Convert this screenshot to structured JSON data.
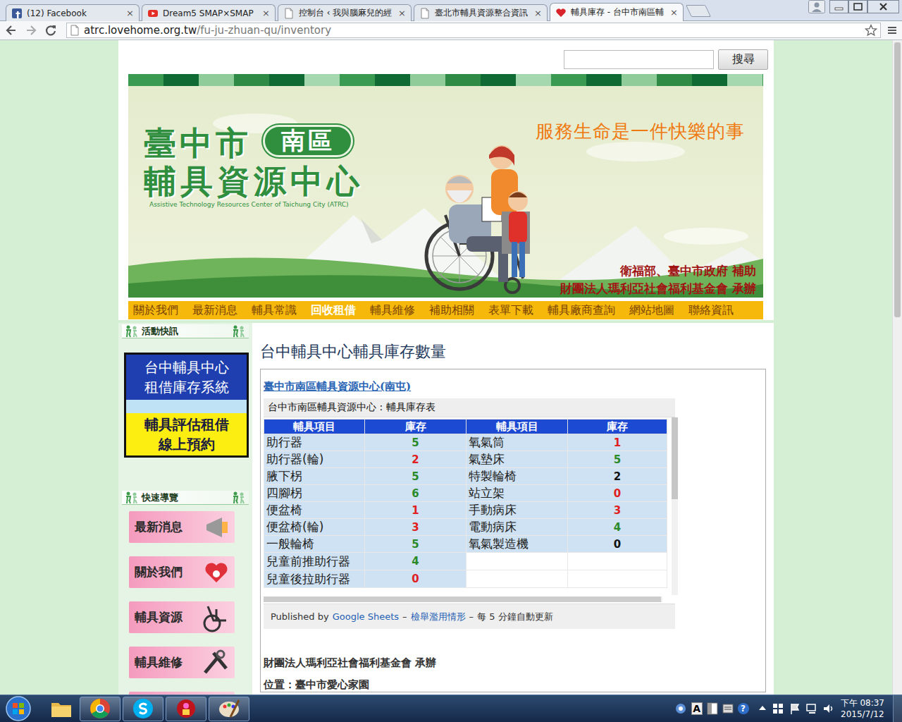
{
  "browser": {
    "tabs": [
      {
        "label": "(12) Facebook",
        "selected": false
      },
      {
        "label": "Dream5 SMAP×SMAP",
        "selected": false
      },
      {
        "label": "控制台 ‹ 我與腦麻兒的經",
        "selected": false
      },
      {
        "label": "臺北市輔具資源整合資訊",
        "selected": false
      },
      {
        "label": "輔具庫存 - 台中市南區輔",
        "selected": true
      }
    ],
    "tab_close": "×",
    "address": {
      "host": "atrc.lovehome.org.tw",
      "path": "/fu-ju-zhuan-qu/inventory"
    }
  },
  "page": {
    "search": {
      "button": "搜尋"
    },
    "banner": {
      "city": "臺中市",
      "district": "南區",
      "center": "輔具資源中心",
      "english": "Assistive Technology Resources Center of Taichung City (ATRC)",
      "slogan": "服務生命是一件快樂的事",
      "credits": [
        "衛福部、臺中市政府 補助",
        "財團法人瑪利亞社會福利基金會 承辦"
      ]
    },
    "nav": [
      {
        "label": "關於我們",
        "selected": false
      },
      {
        "label": "最新消息",
        "selected": false
      },
      {
        "label": "輔具常識",
        "selected": false
      },
      {
        "label": "回收租借",
        "selected": true
      },
      {
        "label": "輔具維修",
        "selected": false
      },
      {
        "label": "補助相關",
        "selected": false
      },
      {
        "label": "表單下載",
        "selected": false
      },
      {
        "label": "輔具廠商查詢",
        "selected": false
      },
      {
        "label": "網站地圖",
        "selected": false
      },
      {
        "label": "聯絡資訊",
        "selected": false
      }
    ],
    "sidebar": {
      "news_header": "活動快訊",
      "promo": {
        "system": [
          "台中輔具中心",
          "租借庫存系統"
        ],
        "booking": [
          "輔具評估租借",
          "線上預約"
        ]
      },
      "quick_header": "快速導覽",
      "quick_links": [
        "最新消息",
        "關於我們",
        "輔具資源",
        "輔具維修"
      ]
    },
    "main": {
      "title": "台中輔具中心輔具庫存數量",
      "sheet": {
        "link": "臺中市南區輔具資源中心(南屯)",
        "subtitle": "台中市南區輔具資源中心 : 輔具庫存表",
        "columns": [
          "輔具項目",
          "庫存",
          "輔具項目",
          "庫存"
        ],
        "rows": [
          {
            "left": {
              "item": "助行器",
              "stock": "5",
              "color": "#2a8a2a"
            },
            "right": {
              "item": "氧氣筒",
              "stock": "1",
              "color": "#e02020"
            }
          },
          {
            "left": {
              "item": "助行器(輪)",
              "stock": "2",
              "color": "#e02020"
            },
            "right": {
              "item": "氣墊床",
              "stock": "5",
              "color": "#2a8a2a"
            }
          },
          {
            "left": {
              "item": "腋下柺",
              "stock": "5",
              "color": "#2a8a2a"
            },
            "right": {
              "item": "特製輪椅",
              "stock": "2",
              "color": "#111111"
            }
          },
          {
            "left": {
              "item": "四腳柺",
              "stock": "6",
              "color": "#2a8a2a"
            },
            "right": {
              "item": "站立架",
              "stock": "0",
              "color": "#e02020"
            }
          },
          {
            "left": {
              "item": "便盆椅",
              "stock": "1",
              "color": "#e02020"
            },
            "right": {
              "item": "手動病床",
              "stock": "3",
              "color": "#e02020"
            }
          },
          {
            "left": {
              "item": "便盆椅(輪)",
              "stock": "3",
              "color": "#e02020"
            },
            "right": {
              "item": "電動病床",
              "stock": "4",
              "color": "#2a8a2a"
            }
          },
          {
            "left": {
              "item": "一般輪椅",
              "stock": "5",
              "color": "#2a8a2a"
            },
            "right": {
              "item": "氧氣製造機",
              "stock": "0",
              "color": "#111111"
            }
          },
          {
            "left": {
              "item": "兒童前推助行器",
              "stock": "4",
              "color": "#2a8a2a"
            },
            "right": null
          },
          {
            "left": {
              "item": "兒童後拉助行器",
              "stock": "0",
              "color": "#e02020"
            },
            "right": null
          }
        ],
        "footer": [
          {
            "text": "Published by",
            "kind": "text"
          },
          {
            "text": "Google Sheets",
            "kind": "link"
          },
          {
            "text": "–",
            "kind": "text"
          },
          {
            "text": "檢舉濫用情形",
            "kind": "link"
          },
          {
            "text": "–",
            "kind": "text"
          },
          {
            "text": "每 5 分鐘自動更新",
            "kind": "text"
          }
        ]
      },
      "footer_lines": [
        "財團法人瑪利亞社會福利基金會 承辦",
        "位置：臺中市愛心家園"
      ]
    }
  },
  "taskbar": {
    "pinned": [
      {
        "running": false
      },
      {
        "running": true
      },
      {
        "running": true
      },
      {
        "running": true
      },
      {
        "running": true
      }
    ],
    "tray": {
      "ime": "A",
      "help": "?"
    },
    "clock": {
      "time": "下午 08:37",
      "date": "2015/7/12"
    }
  }
}
